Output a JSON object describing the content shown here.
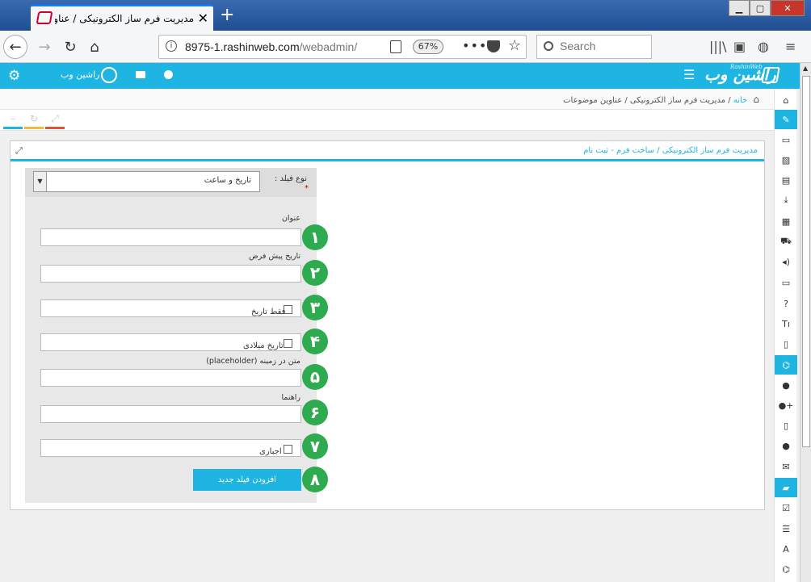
{
  "browser": {
    "tab_title": "مدیریت فرم ساز الکترونیکی / عناو",
    "url_host": "8975-1.rashinweb.com",
    "url_path": "/webadmin/",
    "zoom": "67%",
    "search_placeholder": "Search"
  },
  "header": {
    "user_name": "راشین وب",
    "logo_text": "راشین وب",
    "logo_sub": "RashinWeb"
  },
  "breadcrumb": {
    "home": "خانه",
    "separator": "/",
    "current": "مدیریت فرم ساز الکترونیکی / عناوین موضوعات"
  },
  "panel": {
    "title": "مدیریت فرم ساز الکترونیکی / ساخت فرم - ثبت نام"
  },
  "form": {
    "field_type_label": "نوع فیلد :",
    "required_mark": "*",
    "field_type_value": "تاریخ و ساعت",
    "title_label": "عنوان",
    "default_date_label": "تاریخ پیش فرض",
    "date_only_label": "فقط تاریخ",
    "gregorian_label": "تاریخ میلادی",
    "placeholder_label": "متن در زمینه (placeholder)",
    "help_label": "راهنما",
    "required_label": "اجباری",
    "add_button": "افزودن فیلد جدید"
  },
  "badges": [
    "۱",
    "۲",
    "۳",
    "۴",
    "۵",
    "۶",
    "۷",
    "۸"
  ],
  "colors": {
    "accent": "#1fb5e3",
    "badge": "#2eab4f",
    "browser_chrome": "#2b5797"
  }
}
